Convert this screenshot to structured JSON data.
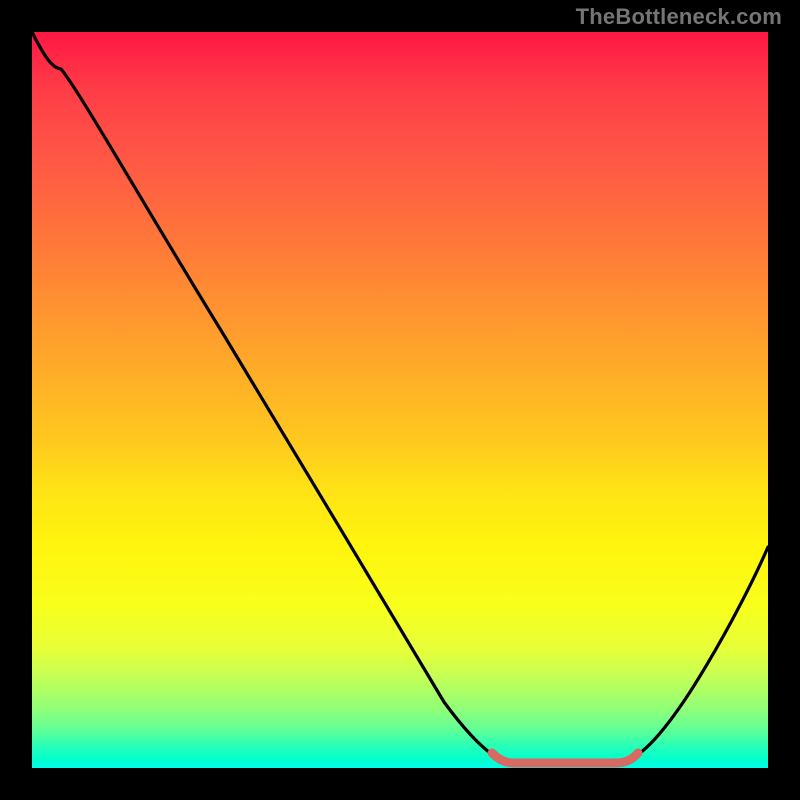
{
  "watermark": "TheBottleneck.com",
  "chart_data": {
    "type": "line",
    "x_fraction": [
      0.0,
      0.04,
      0.1,
      0.18,
      0.26,
      0.34,
      0.42,
      0.5,
      0.56,
      0.61,
      0.65,
      0.7,
      0.75,
      0.8,
      0.86,
      0.93,
      1.0
    ],
    "y_fraction": [
      1.0,
      0.95,
      0.86,
      0.73,
      0.6,
      0.47,
      0.34,
      0.21,
      0.115,
      0.05,
      0.015,
      0.0,
      0.0,
      0.015,
      0.06,
      0.16,
      0.3
    ],
    "title": "",
    "xlabel": "",
    "ylabel": "",
    "xlim": [
      0,
      1
    ],
    "ylim": [
      0,
      1
    ],
    "annotations": {
      "optimal_band_x": [
        0.62,
        0.8
      ]
    },
    "colors": {
      "curve": "#000000",
      "optimal_marker": "#d86a64",
      "gradient_top": "#ff1744",
      "gradient_bottom": "#00ffe8",
      "frame": "#000000"
    }
  }
}
